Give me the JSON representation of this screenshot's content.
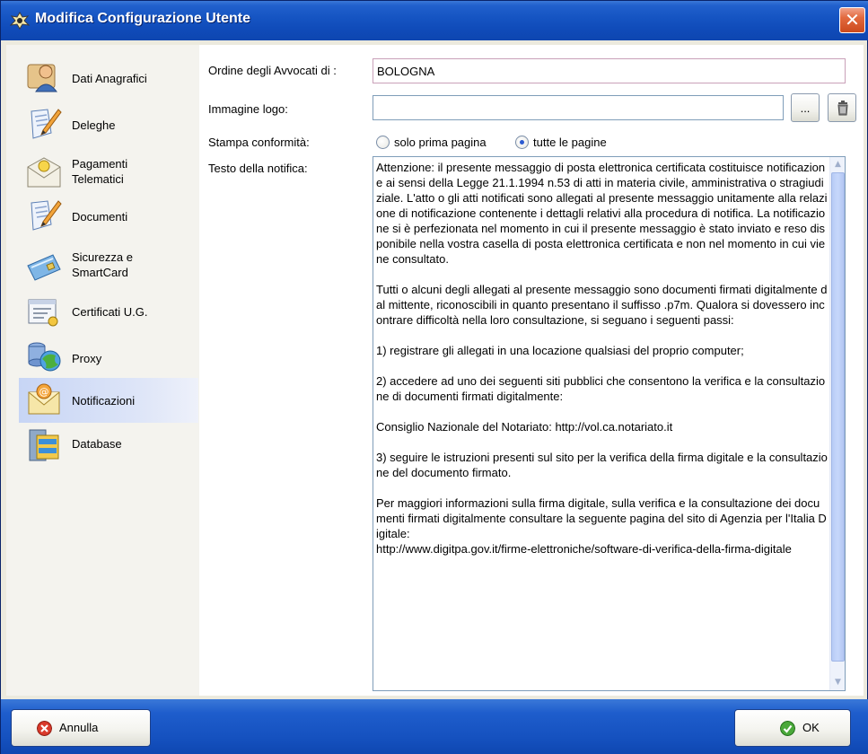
{
  "window": {
    "title": "Modifica Configurazione Utente",
    "close_glyph": "✕"
  },
  "sidebar": {
    "items": [
      {
        "label": "Dati Anagrafici",
        "icon": "person-card-icon"
      },
      {
        "label": "Deleghe",
        "icon": "document-pencil-icon"
      },
      {
        "label": "Pagamenti\nTelematici",
        "icon": "mail-coin-icon"
      },
      {
        "label": "Documenti",
        "icon": "document-pencil-icon"
      },
      {
        "label": "Sicurezza e\nSmartCard",
        "icon": "smartcard-icon"
      },
      {
        "label": "Certificati U.G.",
        "icon": "certificate-icon"
      },
      {
        "label": "Proxy",
        "icon": "network-globe-icon"
      },
      {
        "label": "Notificazioni",
        "icon": "envelope-at-icon"
      },
      {
        "label": "Database",
        "icon": "database-icon"
      }
    ],
    "active_index": 7
  },
  "form": {
    "ordine_label": "Ordine degli Avvocati di :",
    "ordine_value": "BOLOGNA",
    "logo_label": "Immagine logo:",
    "logo_value": "",
    "browse_label": "...",
    "stampa_label": "Stampa conformità:",
    "radio_first": "solo prima pagina",
    "radio_all": "tutte le pagine",
    "radio_selected": "tutte le pagine",
    "testo_label": "Testo della notifica:",
    "testo_value": "Attenzione: il presente messaggio di posta elettronica certificata costituisce notificazione ai sensi della Legge 21.1.1994 n.53 di atti in materia civile, amministrativa o stragiudiziale. L'atto o gli atti notificati sono allegati al presente messaggio unitamente alla relazione di notificazione contenente i dettagli relativi alla procedura di notifica. La notificazione si è perfezionata nel momento in cui il presente messaggio è stato inviato e reso disponibile nella vostra casella di posta elettronica certificata e non nel momento in cui viene consultato.\n\nTutti o alcuni degli allegati al presente messaggio sono documenti firmati digitalmente dal mittente, riconoscibili in quanto presentano il suffisso .p7m. Qualora si dovessero incontrare difficoltà nella loro consultazione, si seguano i seguenti passi:\n\n1) registrare gli allegati in una locazione qualsiasi del proprio computer;\n\n2) accedere ad uno dei seguenti siti pubblici che consentono la verifica e la consultazione di documenti firmati digitalmente:\n\nConsiglio Nazionale del Notariato: http://vol.ca.notariato.it\n\n3) seguire le istruzioni presenti sul sito per la verifica della firma digitale e la consultazione del documento firmato.\n\nPer maggiori informazioni sulla firma digitale, sulla verifica e la consultazione dei documenti firmati digitalmente consultare la seguente pagina del sito di Agenzia per l'Italia Digitale:\nhttp://www.digitpa.gov.it/firme-elettroniche/software-di-verifica-della-firma-digitale"
  },
  "footer": {
    "cancel_label": "Annulla",
    "ok_label": "OK"
  },
  "colors": {
    "titlebar": "#0f4ab8",
    "active_item": "#c7d5f5",
    "cancel_icon": "#d93a2b",
    "ok_icon": "#4aa83a"
  }
}
